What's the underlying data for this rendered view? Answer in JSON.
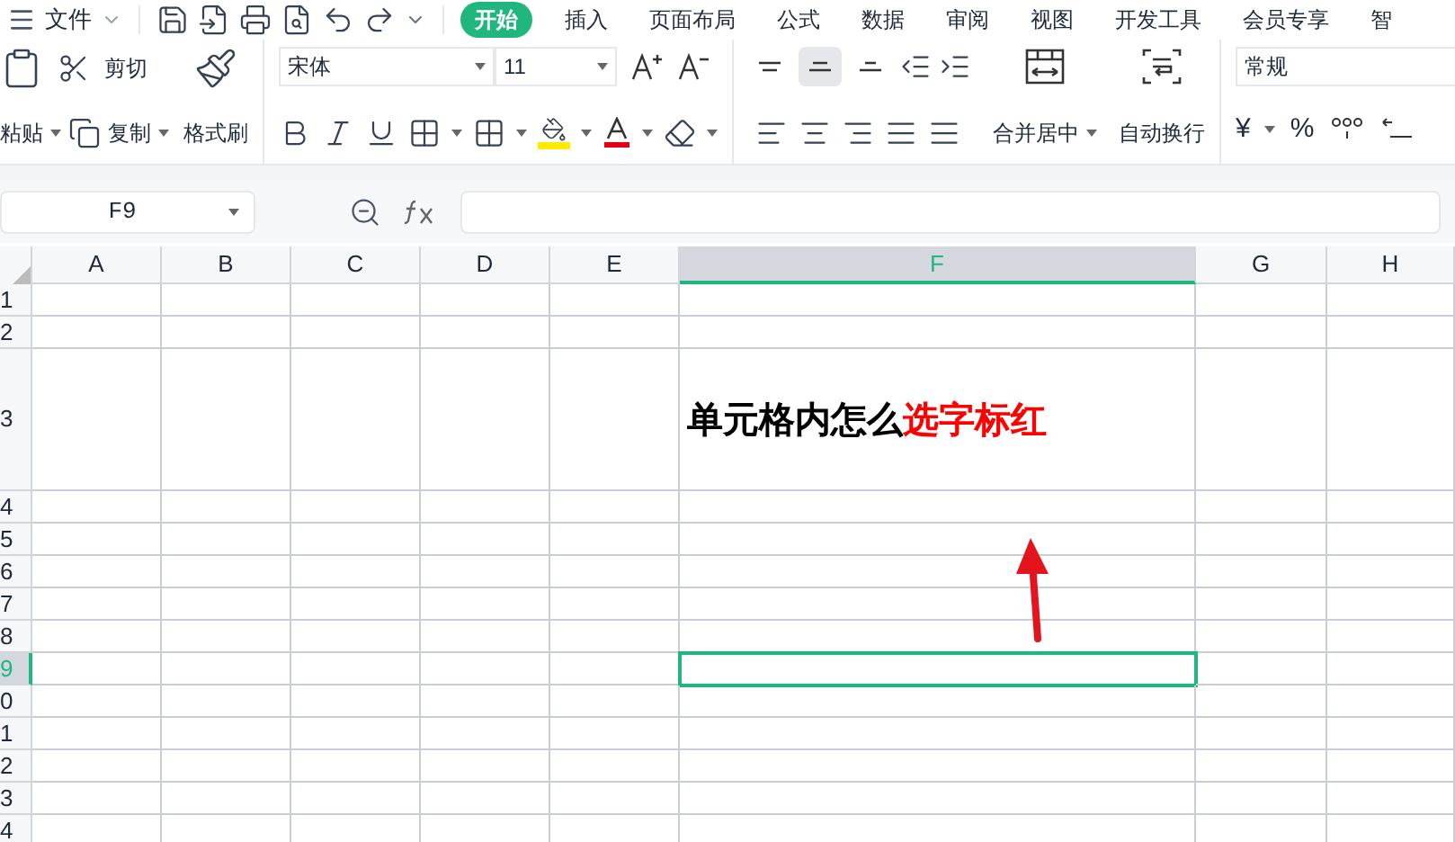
{
  "menu": {
    "file_label": "文件",
    "tabs": [
      {
        "label": "开始",
        "selected": true
      },
      {
        "label": "插入",
        "selected": false
      },
      {
        "label": "页面布局",
        "selected": false
      },
      {
        "label": "公式",
        "selected": false
      },
      {
        "label": "数据",
        "selected": false
      },
      {
        "label": "审阅",
        "selected": false
      },
      {
        "label": "视图",
        "selected": false
      },
      {
        "label": "开发工具",
        "selected": false
      },
      {
        "label": "会员专享",
        "selected": false
      },
      {
        "label": "智",
        "selected": false
      }
    ]
  },
  "ribbon": {
    "clipboard": {
      "paste": "粘贴",
      "cut": "剪切",
      "copy": "复制",
      "format_painter": "格式刷"
    },
    "font": {
      "name": "宋体",
      "size": "11"
    },
    "alignment": {
      "vertical": [
        {
          "kind": "top",
          "selected": false
        },
        {
          "kind": "middle",
          "selected": true
        },
        {
          "kind": "bottom",
          "selected": false
        }
      ],
      "merge": "合并居中",
      "wrap": "自动换行"
    },
    "number": {
      "format": "常规",
      "currency": "¥",
      "percent": "%"
    }
  },
  "formula_bar": {
    "cell_ref": "F9"
  },
  "sheet": {
    "columns": [
      {
        "label": "A",
        "selected": false
      },
      {
        "label": "B",
        "selected": false
      },
      {
        "label": "C",
        "selected": false
      },
      {
        "label": "D",
        "selected": false
      },
      {
        "label": "E",
        "selected": false
      },
      {
        "label": "F",
        "selected": true
      },
      {
        "label": "G",
        "selected": false
      },
      {
        "label": "H",
        "selected": false
      }
    ],
    "rows": [
      {
        "label": "1",
        "selected": false
      },
      {
        "label": "2",
        "selected": false
      },
      {
        "label": "3",
        "selected": false,
        "cell_F": {
          "segments": [
            {
              "text": "单元格内怎么",
              "color": "#000000"
            },
            {
              "text": "选字标红",
              "color": "#ff0000"
            }
          ]
        }
      },
      {
        "label": "4",
        "selected": false
      },
      {
        "label": "5",
        "selected": false
      },
      {
        "label": "6",
        "selected": false
      },
      {
        "label": "7",
        "selected": false
      },
      {
        "label": "8",
        "selected": false
      },
      {
        "label": "9",
        "selected": true
      },
      {
        "label": "0",
        "selected": false
      },
      {
        "label": "1",
        "selected": false
      },
      {
        "label": "2",
        "selected": false
      },
      {
        "label": "3",
        "selected": false
      },
      {
        "label": "4",
        "selected": false
      }
    ]
  }
}
